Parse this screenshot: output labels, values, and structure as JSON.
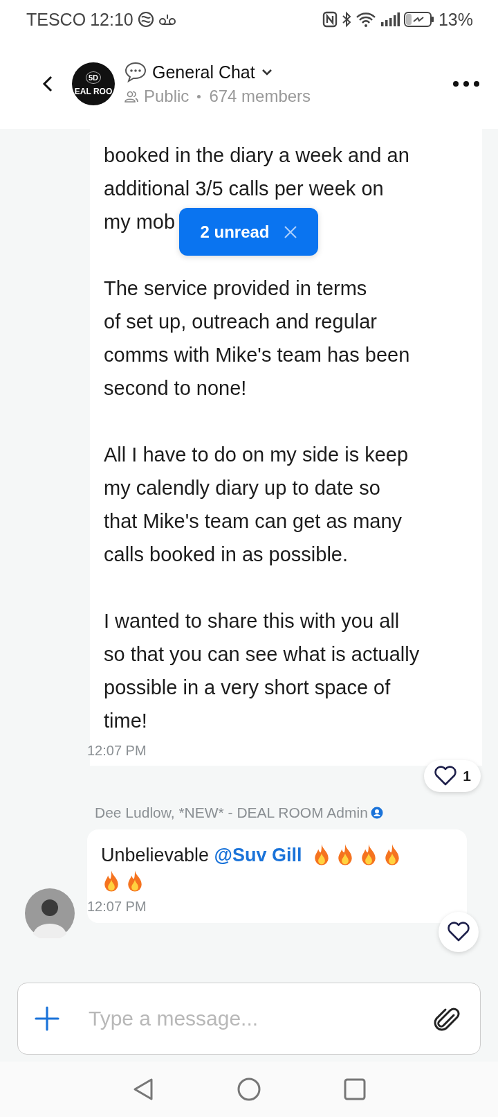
{
  "status_bar": {
    "carrier": "TESCO",
    "time": "12:10",
    "battery": "13%"
  },
  "header": {
    "logo_lines": [
      "5D",
      "EAL ROO"
    ],
    "title": "General Chat",
    "visibility": "Public",
    "members": "674 members"
  },
  "messages": [
    {
      "kind": "text",
      "paragraphs": [
        {
          "lines": [
            "booked in the diary a week and an",
            "additional 3/5 calls per week on",
            "my mob"
          ]
        },
        {
          "lines": [
            "The service provided in terms",
            "of set up, outreach and regular",
            "comms with Mike's team has been",
            "second to none!"
          ]
        },
        {
          "lines": [
            "All I have to do on my side  is keep",
            "my calendly diary up to date so",
            "that Mike's team can get as many",
            "calls booked in as possible."
          ]
        },
        {
          "lines": [
            "I wanted to share this with you all",
            "so that you can see what is actually",
            "possible in a very short space of",
            "time!"
          ]
        }
      ],
      "time": "12:07 PM",
      "likes": "1"
    },
    {
      "kind": "mention",
      "sender": "Dee Ludlow, *NEW* - DEAL ROOM Admin",
      "admin": true,
      "text": "Unbelievable",
      "mention": "@Suv Gill",
      "emojis": [
        {
          "kind": "fire"
        },
        {
          "kind": "fire"
        },
        {
          "kind": "fire"
        },
        {
          "kind": "fire"
        },
        {
          "kind": "fire"
        },
        {
          "kind": "fire"
        }
      ],
      "time": "12:07 PM"
    }
  ],
  "unread_toast": {
    "label": "2 unread"
  },
  "composer": {
    "placeholder": "Type a message..."
  }
}
